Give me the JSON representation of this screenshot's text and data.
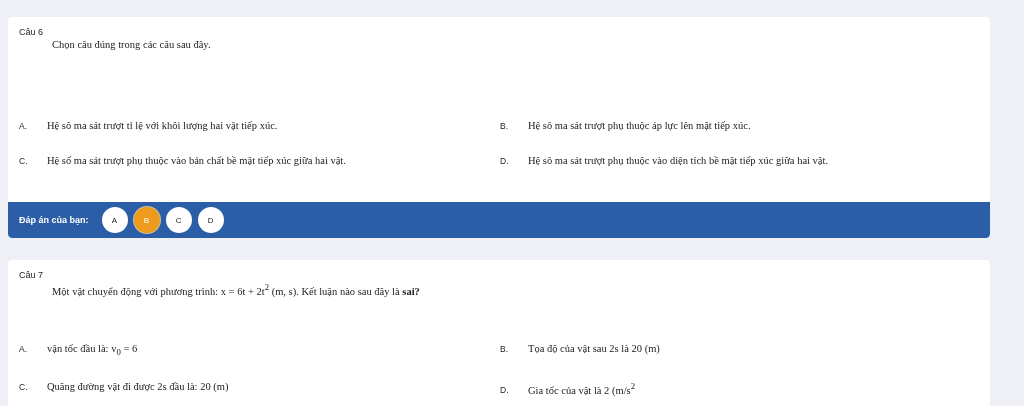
{
  "questions": [
    {
      "label": "Câu 6",
      "stem": "Chọn câu đúng trong các câu sau đây.",
      "options": [
        {
          "letter": "A.",
          "text": "Hệ sô ma sát trượt tỉ lệ với khôi lượng hai vật tiếp xúc."
        },
        {
          "letter": "B.",
          "text": "Hệ sô ma sát trượt phụ thuộc áp lực lên mặt tiếp xúc."
        },
        {
          "letter": "C.",
          "text": "Hệ số ma sát trượt phụ thuộc vào bản chất bề mặt tiếp xúc giữa hai vật."
        },
        {
          "letter": "D.",
          "text": "Hệ sô ma sát trượt phụ thuộc vào diện tích bề mặt tiếp xúc giữa hai vật."
        }
      ],
      "answer": {
        "label": "Đáp án của bạn:",
        "choices": [
          {
            "text": "A",
            "selected": false
          },
          {
            "text": "B",
            "selected": true
          },
          {
            "text": "C",
            "selected": false
          },
          {
            "text": "D",
            "selected": false
          }
        ]
      }
    },
    {
      "label": "Câu 7",
      "stem": "Một vật chuyển động với phương trình: x = 6t + 2t$^{2}$ (m, s). Kết luận nào sau đây là **sai?**",
      "options": [
        {
          "letter": "A.",
          "text": "vận tốc đầu là: v$_{0}$ = 6"
        },
        {
          "letter": "B.",
          "text": "Tọa độ của vật sau 2s là 20 (m)"
        },
        {
          "letter": "C.",
          "text": "Quãng đường vật đi được 2s đầu là: 20 (m)"
        },
        {
          "letter": "D.",
          "text": "Gia tốc của vật là 2 (m/s$^{2}$"
        }
      ]
    }
  ]
}
